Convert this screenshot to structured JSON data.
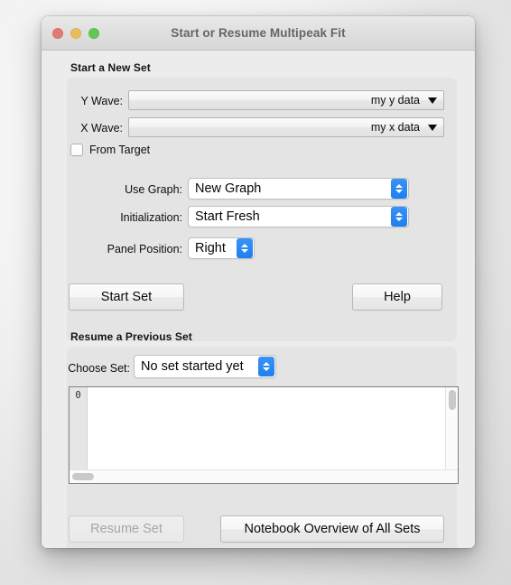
{
  "window": {
    "title": "Start or Resume Multipeak Fit",
    "traffic_lights": [
      {
        "name": "close-button",
        "color": "#e2786e"
      },
      {
        "name": "minimize-button",
        "color": "#e8bc5c"
      },
      {
        "name": "zoom-button",
        "color": "#62c554"
      }
    ]
  },
  "new_set": {
    "heading": "Start a New Set",
    "y_wave": {
      "label": "Y Wave:",
      "value": "my y data",
      "icon": "triangle-down-icon"
    },
    "x_wave": {
      "label": "X Wave:",
      "value": "my x data",
      "icon": "triangle-down-icon"
    },
    "from_target": {
      "label": "From Target",
      "checked": false
    },
    "use_graph": {
      "label": "Use Graph:",
      "value": "New Graph",
      "options": [
        "New Graph"
      ]
    },
    "initialization": {
      "label": "Initialization:",
      "value": "Start Fresh",
      "options": [
        "Start Fresh"
      ]
    },
    "panel_position": {
      "label": "Panel Position:",
      "value": "Right",
      "options": [
        "Right"
      ]
    },
    "start_set_button": "Start Set",
    "help_button": "Help"
  },
  "resume_set": {
    "heading": "Resume a Previous Set",
    "choose_set": {
      "label": "Choose Set:",
      "value": "No set started yet",
      "options": [
        "No set started yet"
      ]
    },
    "notebook": {
      "gutter_lines": [
        "0"
      ],
      "content": ""
    },
    "resume_set_button": "Resume Set",
    "resume_set_enabled": false,
    "notebook_overview_button": "Notebook Overview of All Sets"
  },
  "colors": {
    "window_bg": "#ececec",
    "group_bg": "#e4e4e4",
    "accent_blue": "#1f7ff0",
    "title_text": "#62666a"
  }
}
